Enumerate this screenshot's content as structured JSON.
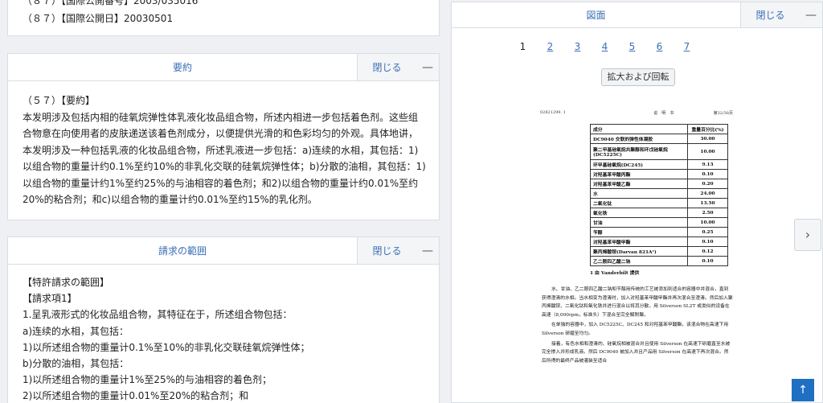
{
  "top_card": {
    "line1": "（８７）【国際公開番号】2003/035016",
    "line2": "（８７）【国際公開日】20030501"
  },
  "abstract": {
    "title": "要約",
    "close_label": "閉じる",
    "collapse": "—",
    "heading": "（５７）【要約】",
    "text": "本发明涉及包括内相的硅氧烷弹性体乳液化妆品组合物，所述内相进一步包括着色剂。这些组合物意在向使用者的皮肤递送该着色剂成分，以便提供光滑的和色彩均匀的外观。具体地讲，本发明涉及一种包括乳液的化妆品组合物，所述乳液进一步包括：a)连续的水相，其包括：1)以组合物的重量计约0.1%至约10%的非乳化交联的硅氧烷弹性体；b)分散的油相，其包括：1)以组合物的重量计约1%至约25%的与油相容的着色剂；和2)以组合物的重量计约0.01%至约20%的粘合剂；和c)以组合物的重量计约0.01%至约15%的乳化剂。"
  },
  "claims": {
    "title": "請求の範囲",
    "close_label": "閉じる",
    "collapse": "—",
    "lines": [
      "【特許請求の範囲】",
      "【請求項1】",
      "1.呈乳液形式的化妆品组合物，其特征在于，所述组合物包括：",
      "a)连续的水相，其包括：",
      "1)以所述组合物的重量计0.1%至10%的非乳化交联硅氧烷弹性体；",
      "b)分散的油相，其包括：",
      "1)以所述组合物的重量计1%至25%的与油相容的着色剂；",
      "2)以所述组合物的重量计0.01%至20%的粘合剂；和"
    ]
  },
  "figures": {
    "title": "図面",
    "close_label": "閉じる",
    "collapse": "—",
    "pages": [
      "1",
      "2",
      "3",
      "4",
      "5",
      "6",
      "7"
    ],
    "current_page": "1",
    "zoom_button": "拡大および回転",
    "next_icon": "chevron-right-icon",
    "top_icon": "arrow-up-icon"
  },
  "document": {
    "header_left": "02821299. 1",
    "header_mid": "说　明　书",
    "header_right": "第32/38页",
    "col1": "成分",
    "col2": "重量百分比(%)",
    "rows": [
      [
        "DC9040 交联的弹性体凝胶",
        "30.00"
      ],
      [
        "聚二甲基硅氧烷共聚醇和环戊硅氧烷 (DC5225C)",
        "10.00"
      ],
      [
        "环甲基硅氧烷(DC245)",
        "9.13"
      ],
      [
        "对羟基苯甲酸丙酯",
        "0.10"
      ],
      [
        "对羟基苯甲酸乙酯",
        "0.20"
      ],
      [
        "水",
        "24.00"
      ],
      [
        "二氧化钛",
        "13.50"
      ],
      [
        "氧化铁",
        "2.50"
      ],
      [
        "甘油",
        "10.00"
      ],
      [
        "苄醇",
        "0.25"
      ],
      [
        "对羟基苯甲酸甲酯",
        "0.10"
      ],
      [
        "聚丙烯酸铵(Darvan 821A¹)",
        "0.12"
      ],
      [
        "乙二胺四乙酸二钠",
        "0.10"
      ]
    ],
    "footnote": "1 由 Vanderbilt 提供",
    "para1": "水、甘油、乙二胺四乙酸二钠和苄醇用传统的工艺被添加到适合的容器中并混合，直到获得澄清的水相。当水相变为澄清时，加入对羟基苯甲酸甲酯并再次混合至澄清。然后加入聚丙烯酸铵、二氧化钛和氧化铁并进行混合以将其分散，用 Silverson SL2T 或类似的设备在高速（8,000rpm，标准头）下混合至完全解附聚。",
    "para2": "在单独的容器中，加入 DC5225C、DC245 和对羟基苯甲酸酯，该混合物在高速下用 Silverson 研磨至均匀。",
    "para3": "接着，有色水相和澄清的、硅氧烷相被混合并且使用 Silverson 在高速下研磨直至水被完全掺入并形成乳液。然后 DC9040 被加入并且产品用 Silverson 在高速下再次混合。然后所得的最终产品被灌装至适合"
  }
}
